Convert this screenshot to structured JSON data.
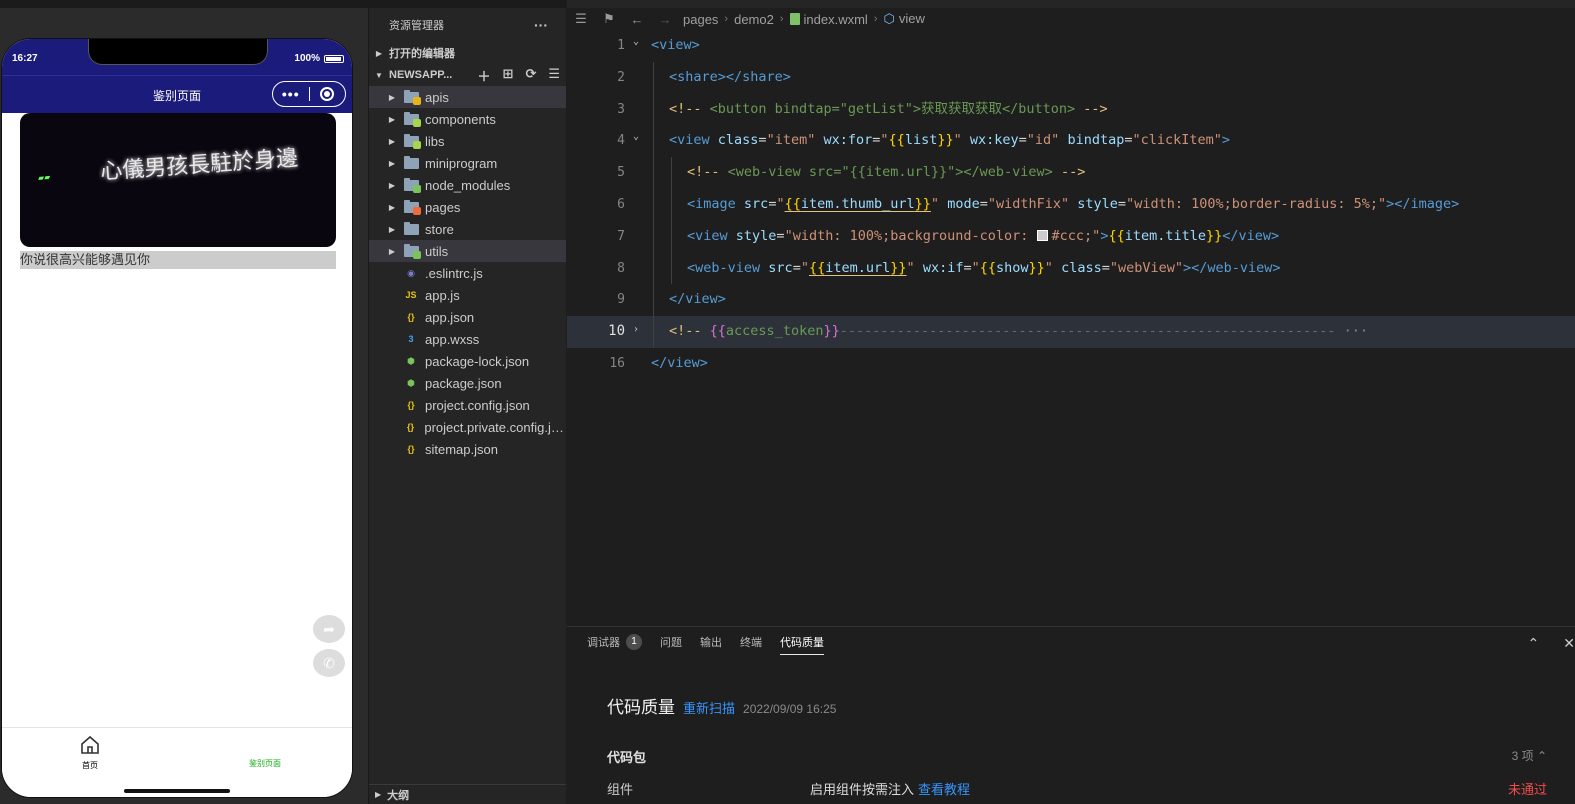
{
  "simulator": {
    "time": "16:27",
    "battery": "100%",
    "nav_title": "鉴别页面",
    "card_title": "你说很高兴能够遇见你",
    "image_caption": "心儀男孩長駐於身邊",
    "tabs": [
      {
        "label": "首页"
      },
      {
        "label": "鉴别页面"
      }
    ]
  },
  "explorer": {
    "title": "资源管理器",
    "open_editors": "打开的编辑器",
    "workspace": "NEWSAPP...",
    "outline": "大纲",
    "files": [
      {
        "name": "apis",
        "type": "folder",
        "badge": "#e8b417"
      },
      {
        "name": "components",
        "type": "folder",
        "badge": "#a5d64c"
      },
      {
        "name": "libs",
        "type": "folder",
        "badge": "#a5d64c"
      },
      {
        "name": "miniprogram",
        "type": "folder",
        "badge": ""
      },
      {
        "name": "node_modules",
        "type": "folder",
        "badge": "#7bc45c"
      },
      {
        "name": "pages",
        "type": "folder",
        "badge": "#f06a3a"
      },
      {
        "name": "store",
        "type": "folder",
        "badge": ""
      },
      {
        "name": "utils",
        "type": "folder",
        "badge": "#7bc45c"
      },
      {
        "name": ".eslintrc.js",
        "type": "file",
        "icon": "eslint-icon"
      },
      {
        "name": "app.js",
        "type": "file",
        "icon": "js-icon"
      },
      {
        "name": "app.json",
        "type": "file",
        "icon": "json-icon"
      },
      {
        "name": "app.wxss",
        "type": "file",
        "icon": "css-icon"
      },
      {
        "name": "package-lock.json",
        "type": "file",
        "icon": "npm-icon"
      },
      {
        "name": "package.json",
        "type": "file",
        "icon": "npm-icon"
      },
      {
        "name": "project.config.json",
        "type": "file",
        "icon": "json-icon"
      },
      {
        "name": "project.private.config.js...",
        "type": "file",
        "icon": "json-icon"
      },
      {
        "name": "sitemap.json",
        "type": "file",
        "icon": "json-icon"
      }
    ]
  },
  "editor": {
    "breadcrumb": [
      "pages",
      "demo2",
      "index.wxml",
      "view"
    ],
    "line_numbers": [
      "1",
      "2",
      "3",
      "4",
      "5",
      "6",
      "7",
      "8",
      "9",
      "10",
      "16"
    ]
  },
  "panel": {
    "tabs": [
      "调试器",
      "问题",
      "输出",
      "终端",
      "代码质量"
    ],
    "debugger_count": "1",
    "quality_title": "代码质量",
    "rescan": "重新扫描",
    "scan_time": "2022/09/09 16:25",
    "package_title": "代码包",
    "package_count": "3 项",
    "component_label": "组件",
    "component_desc": "启用组件按需注入",
    "component_link": "查看教程",
    "component_status": "未通过"
  }
}
